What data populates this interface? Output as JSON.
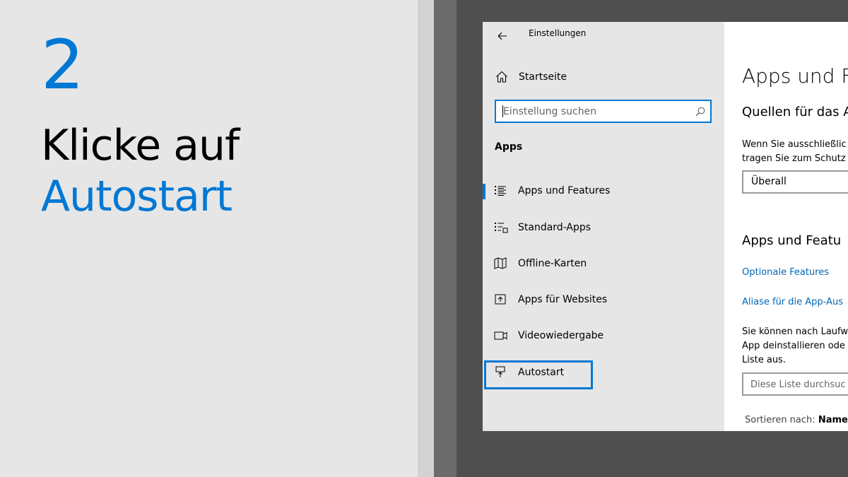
{
  "instruction": {
    "step_number": "2",
    "line1": "Klicke auf",
    "line2": "Autostart"
  },
  "window": {
    "title": "Einstellungen",
    "back_icon": "back-arrow-icon"
  },
  "nav": {
    "home": {
      "label": "Startseite",
      "icon": "home-icon"
    },
    "search": {
      "placeholder": "Einstellung suchen",
      "value": "",
      "icon": "search-icon"
    },
    "section_label": "Apps",
    "items": [
      {
        "label": "Apps und Features",
        "icon": "apps-features-icon",
        "active": true
      },
      {
        "label": "Standard-Apps",
        "icon": "default-apps-icon",
        "active": false
      },
      {
        "label": "Offline-Karten",
        "icon": "map-icon",
        "active": false
      },
      {
        "label": "Apps für Websites",
        "icon": "apps-websites-icon",
        "active": false
      },
      {
        "label": "Videowiedergabe",
        "icon": "video-icon",
        "active": false
      },
      {
        "label": "Autostart",
        "icon": "startup-icon",
        "active": false,
        "highlighted": true
      }
    ]
  },
  "content": {
    "heading": "Apps und Fe",
    "sources_heading": "Quellen für das A",
    "sources_desc_line1": "Wenn Sie ausschließlic",
    "sources_desc_line2": "tragen Sie zum Schutz",
    "sources_dropdown_value": "Überall",
    "features_heading": "Apps und Featu",
    "link_optional": "Optionale Features",
    "link_aliases": "Aliase für die App-Aus",
    "list_desc_line1": "Sie können nach Laufw",
    "list_desc_line2": "App deinstallieren ode",
    "list_desc_line3": "Liste aus.",
    "list_search_placeholder": "Diese Liste durchsuc",
    "sort_label": "Sortieren nach:",
    "sort_value": "Name"
  },
  "colors": {
    "accent": "#0078d4",
    "link": "#0067b8",
    "nav_bg": "#e6e6e6",
    "frame_dark": "#4f4f4f"
  }
}
